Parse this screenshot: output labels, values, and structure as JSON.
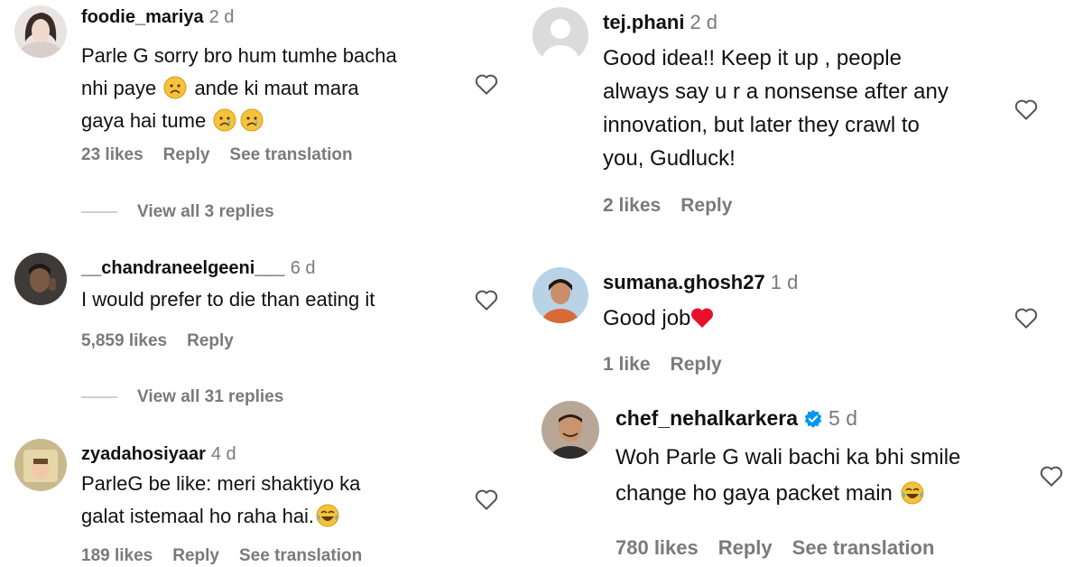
{
  "comments_left": [
    {
      "username": "foodie_mariya",
      "time": "2 d",
      "lines": [
        "Parle G sorry bro hum tumhe bacha",
        "nhi paye",
        "ande ki maut mara",
        "gaya hai tume"
      ],
      "likes": "23 likes",
      "reply": "Reply",
      "translate": "See translation",
      "view_replies": "View all 3 replies"
    },
    {
      "username": "__chandraneelgeeni___",
      "time": "6 d",
      "lines": [
        "I would prefer to die than eating it"
      ],
      "likes": "5,859 likes",
      "reply": "Reply",
      "view_replies": "View all 31 replies"
    },
    {
      "username": "zyadahosiyaar",
      "time": "4 d",
      "lines": [
        "ParleG be like: meri shaktiyo ka",
        "galat istemaal ho raha hai."
      ],
      "likes": "189 likes",
      "reply": "Reply",
      "translate": "See translation"
    }
  ],
  "comments_right": [
    {
      "username": "tej.phani",
      "time": "2 d",
      "lines": [
        "Good idea!! Keep it up , people",
        "always say u r a nonsense after any",
        "innovation, but later they crawl to",
        "you, Gudluck!"
      ],
      "likes": "2 likes",
      "reply": "Reply"
    },
    {
      "username": "sumana.ghosh27",
      "time": "1 d",
      "lines": [
        "Good job"
      ],
      "likes": "1 like",
      "reply": "Reply"
    },
    {
      "username": "chef_nehalkarkera",
      "time": "5 d",
      "lines": [
        "Woh Parle G wali bachi ka bhi smile",
        "change ho gaya packet main"
      ],
      "likes": "780 likes",
      "reply": "Reply",
      "translate": "See translation"
    }
  ],
  "colors": {
    "text": "#111111",
    "muted": "#7a7a7a",
    "verified": "#0095f6",
    "heart_red": "#e8112d"
  },
  "icons": [
    "heart-outline-icon",
    "sad-face-emoji",
    "crying-face-emoji",
    "laughing-tears-emoji",
    "red-heart-emoji",
    "verified-badge-icon"
  ]
}
